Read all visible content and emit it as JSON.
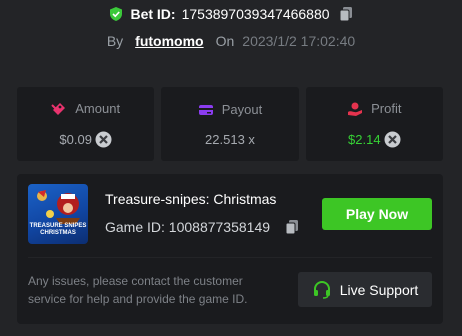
{
  "bet": {
    "id_label": "Bet ID:",
    "id_value": "1753897039347466880",
    "by_label": "By",
    "username": "futomomo",
    "on_label": "On",
    "timestamp": "2023/1/2 17:02:40"
  },
  "stats": {
    "amount": {
      "label": "Amount",
      "value": "$0.09"
    },
    "payout": {
      "label": "Payout",
      "value": "22.513 x"
    },
    "profit": {
      "label": "Profit",
      "value": "$2.14"
    }
  },
  "game": {
    "thumb_text": "TREASURE SNIPES CHRISTMAS",
    "title": "Treasure-snipes: Christmas",
    "id_label": "Game ID:",
    "id_value": "1008877358149",
    "play_label": "Play Now"
  },
  "help": {
    "text": "Any issues, please contact the customer service for help and provide the game ID.",
    "support_label": "Live Support"
  },
  "colors": {
    "background": "#232427",
    "card": "#1a1b1e",
    "accent_green": "#3dc625",
    "profit_green": "#36d135",
    "amount_icon": "#e8336e",
    "payout_icon": "#8b3cf0",
    "profit_icon": "#e5334e",
    "shield": "#3bc93a"
  }
}
